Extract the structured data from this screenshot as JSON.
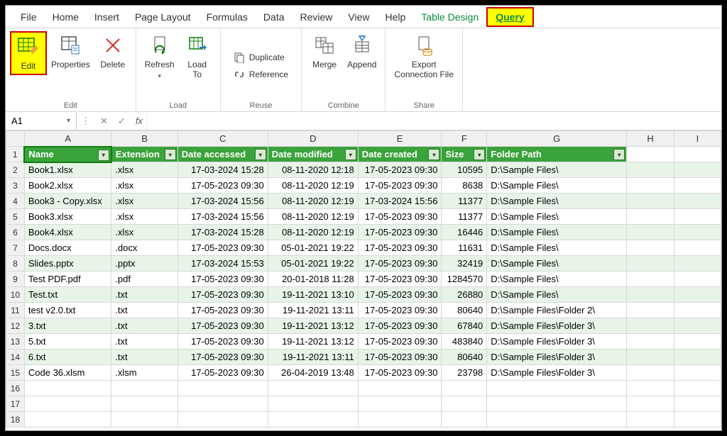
{
  "menu": [
    "File",
    "Home",
    "Insert",
    "Page Layout",
    "Formulas",
    "Data",
    "Review",
    "View",
    "Help",
    "Table Design",
    "Query"
  ],
  "ribbon": {
    "edit": {
      "label": "Edit",
      "items": {
        "edit": "Edit",
        "properties": "Properties",
        "delete": "Delete"
      }
    },
    "load": {
      "label": "Load",
      "items": {
        "refresh": "Refresh",
        "loadto": "Load\nTo"
      }
    },
    "reuse": {
      "label": "Reuse",
      "items": {
        "duplicate": "Duplicate",
        "reference": "Reference"
      }
    },
    "combine": {
      "label": "Combine",
      "items": {
        "merge": "Merge",
        "append": "Append"
      }
    },
    "share": {
      "label": "Share",
      "items": {
        "export": "Export\nConnection File"
      }
    }
  },
  "namebox": "A1",
  "fx": "fx",
  "columns": [
    "A",
    "B",
    "C",
    "D",
    "E",
    "F",
    "G",
    "H",
    "I"
  ],
  "headers": [
    "Name",
    "Extension",
    "Date accessed",
    "Date modified",
    "Date created",
    "Size",
    "Folder Path"
  ],
  "rows": [
    {
      "n": "Book1.xlsx",
      "e": ".xlsx",
      "a": "17-03-2024 15:28",
      "m": "08-11-2020 12:18",
      "c": "17-05-2023 09:30",
      "s": "10595",
      "p": "D:\\Sample Files\\"
    },
    {
      "n": "Book2.xlsx",
      "e": ".xlsx",
      "a": "17-05-2023 09:30",
      "m": "08-11-2020 12:19",
      "c": "17-05-2023 09:30",
      "s": "8638",
      "p": "D:\\Sample Files\\"
    },
    {
      "n": "Book3 - Copy.xlsx",
      "e": ".xlsx",
      "a": "17-03-2024 15:56",
      "m": "08-11-2020 12:19",
      "c": "17-03-2024 15:56",
      "s": "11377",
      "p": "D:\\Sample Files\\"
    },
    {
      "n": "Book3.xlsx",
      "e": ".xlsx",
      "a": "17-03-2024 15:56",
      "m": "08-11-2020 12:19",
      "c": "17-05-2023 09:30",
      "s": "11377",
      "p": "D:\\Sample Files\\"
    },
    {
      "n": "Book4.xlsx",
      "e": ".xlsx",
      "a": "17-03-2024 15:28",
      "m": "08-11-2020 12:19",
      "c": "17-05-2023 09:30",
      "s": "16446",
      "p": "D:\\Sample Files\\"
    },
    {
      "n": "Docs.docx",
      "e": ".docx",
      "a": "17-05-2023 09:30",
      "m": "05-01-2021 19:22",
      "c": "17-05-2023 09:30",
      "s": "11631",
      "p": "D:\\Sample Files\\"
    },
    {
      "n": "Slides.pptx",
      "e": ".pptx",
      "a": "17-03-2024 15:53",
      "m": "05-01-2021 19:22",
      "c": "17-05-2023 09:30",
      "s": "32419",
      "p": "D:\\Sample Files\\"
    },
    {
      "n": "Test PDF.pdf",
      "e": ".pdf",
      "a": "17-05-2023 09:30",
      "m": "20-01-2018 11:28",
      "c": "17-05-2023 09:30",
      "s": "1284570",
      "p": "D:\\Sample Files\\"
    },
    {
      "n": "Test.txt",
      "e": ".txt",
      "a": "17-05-2023 09:30",
      "m": "19-11-2021 13:10",
      "c": "17-05-2023 09:30",
      "s": "26880",
      "p": "D:\\Sample Files\\"
    },
    {
      "n": "test v2.0.txt",
      "e": ".txt",
      "a": "17-05-2023 09:30",
      "m": "19-11-2021 13:11",
      "c": "17-05-2023 09:30",
      "s": "80640",
      "p": "D:\\Sample Files\\Folder 2\\"
    },
    {
      "n": "3.txt",
      "e": ".txt",
      "a": "17-05-2023 09:30",
      "m": "19-11-2021 13:12",
      "c": "17-05-2023 09:30",
      "s": "67840",
      "p": "D:\\Sample Files\\Folder 3\\"
    },
    {
      "n": "5.txt",
      "e": ".txt",
      "a": "17-05-2023 09:30",
      "m": "19-11-2021 13:12",
      "c": "17-05-2023 09:30",
      "s": "483840",
      "p": "D:\\Sample Files\\Folder 3\\"
    },
    {
      "n": "6.txt",
      "e": ".txt",
      "a": "17-05-2023 09:30",
      "m": "19-11-2021 13:11",
      "c": "17-05-2023 09:30",
      "s": "80640",
      "p": "D:\\Sample Files\\Folder 3\\"
    },
    {
      "n": "Code 36.xlsm",
      "e": ".xlsm",
      "a": "17-05-2023 09:30",
      "m": "26-04-2019 13:48",
      "c": "17-05-2023 09:30",
      "s": "23798",
      "p": "D:\\Sample Files\\Folder 3\\"
    }
  ],
  "emptyRows": [
    16,
    17,
    18
  ]
}
